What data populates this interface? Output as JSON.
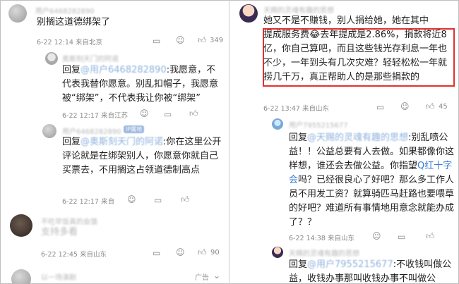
{
  "left": {
    "c1": {
      "user": "用户6468282890",
      "text": "别搁这道德绑架了",
      "meta": "6-22 12:14  来自北京",
      "likes": "349"
    },
    "c2": {
      "user": "奥斯刻天门的阿诺",
      "reply_prefix": "回复",
      "mention": "@用户6468282890",
      "text": ":我愿意，不代表我替你愿意。别乱扣帽子，我愿意被“绑架”，不代表我让你被“绑架”",
      "meta": "6-22 12:17  来自江苏"
    },
    "c3": {
      "user": "用户6468282890",
      "badge": "IP属地",
      "reply_prefix": "回复",
      "mention": "@奥斯刻天门的阿诺",
      "text": ":你在这里公开评论就是在绑架别人，你愿意你就自己买票去，不用搁这占领道德制高点",
      "meta": "6-22 12:17  来自"
    },
    "c4": {
      "user": "不吃早饭真的会饿",
      "text": "支持多看",
      "meta": "6-22 12:45  来自山东",
      "likes": "90"
    },
    "c5": {
      "user": "以一场演剧",
      "ad": "广告"
    }
  },
  "right": {
    "c1": {
      "user": "天赐的灵魂有趣的思想",
      "text_line1": "她又不是不赚钱，别人捐给她，她在其中",
      "text_rest": "提成服务费😂去年提成是2.86%，捐款将近8亿，你自己算吧，而且这些钱光存利息一年也不少，一年到头有几次灾难？轻轻松松一年就捞几千万，真正帮助人的是那些捐款的",
      "meta": "6-22 13:47  来自山东",
      "likes": "45"
    },
    "c2": {
      "user": "用户7955215677",
      "reply_prefix": "回复",
      "mention": "@天赐的灵魂有趣的思想",
      "text_a": ":别乱喷公益！！公益总要有人去做。如果都像你这样想，谁还会去做公益。你指望",
      "link": "Q红十字会",
      "text_b": "吗？已经很良心了好吧？那么多工作人员不用发工资？就算骑匹马赶路也要喂草的好吧？难道所有事情地用意念就能办成了？？",
      "meta": "6-22 14:38  来自山东"
    },
    "c3": {
      "user": "天赐的灵魂有趣的思想",
      "reply_prefix": "回复",
      "mention": "@用户7955215677",
      "text": ":不收钱叫做公益，收钱办事那叫收钱办事不叫做公"
    }
  },
  "icons": {
    "comment": "comment-icon",
    "emoji": "emoji-icon",
    "like": "like-icon"
  }
}
